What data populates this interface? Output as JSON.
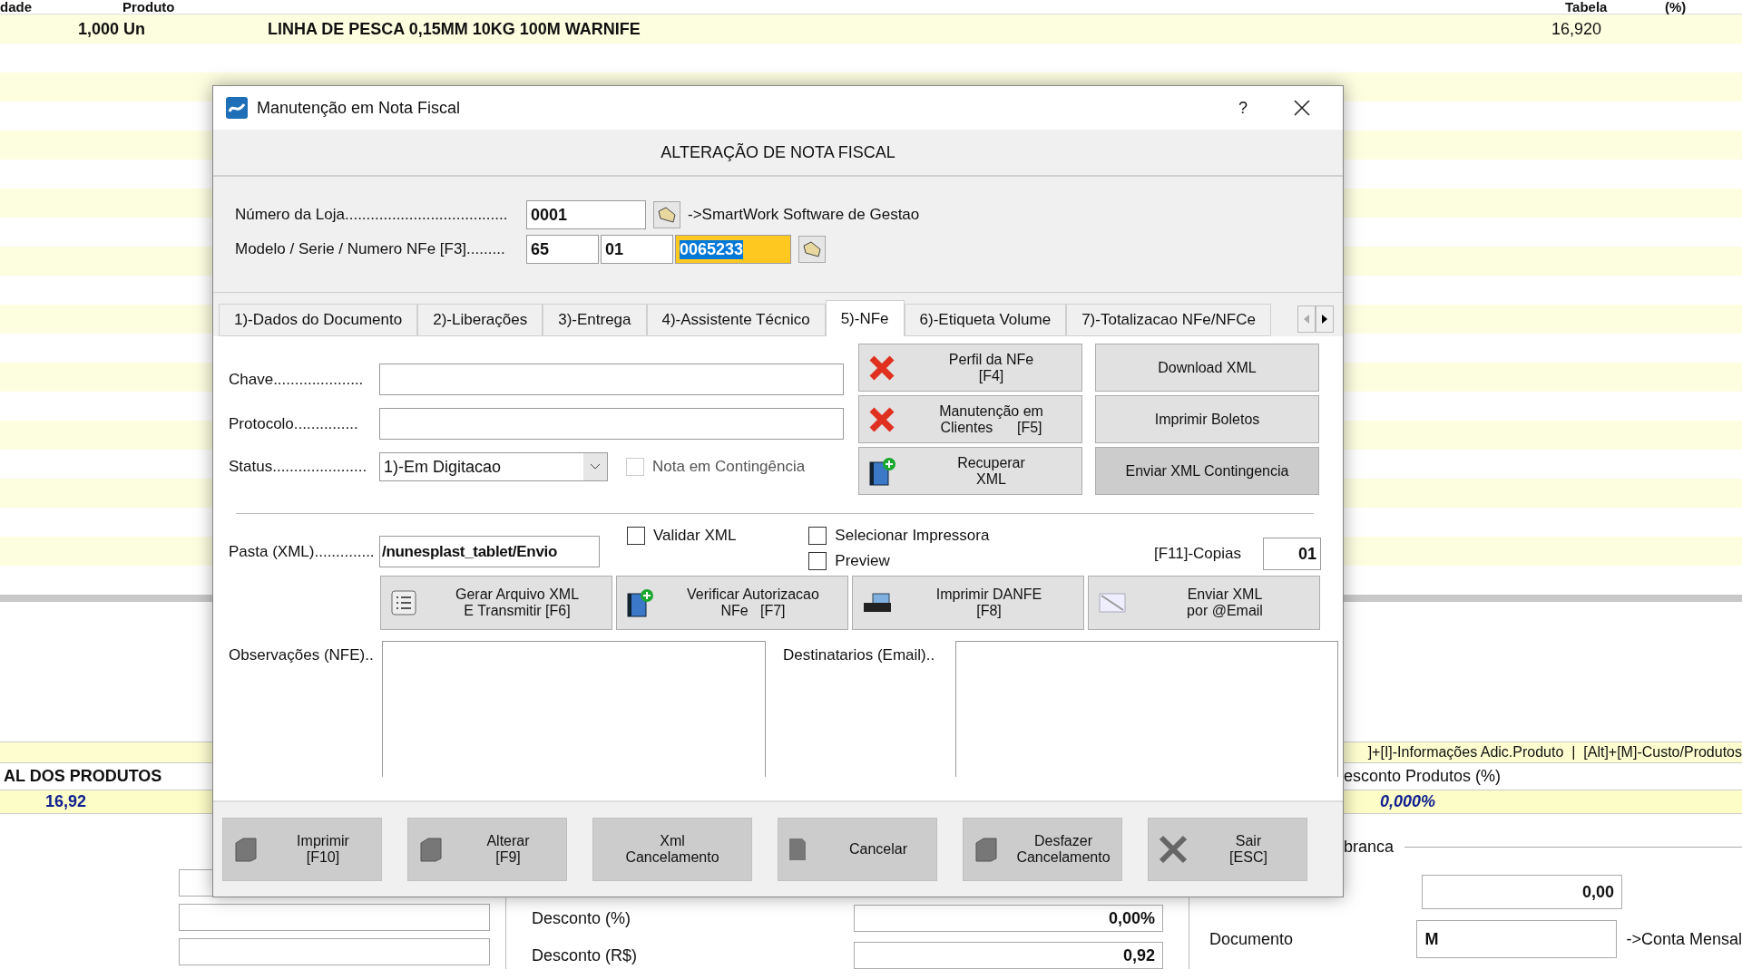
{
  "background_table": {
    "columns": [
      "dade",
      "Produto",
      "Tabela",
      "(%)"
    ],
    "rows": [
      {
        "quantity": "1,000 Un",
        "product": "LINHA DE PESCA 0,15MM 10KG 100M WARNIFE",
        "price": "16,920"
      }
    ]
  },
  "background_footer": {
    "shortcut_hint": "]+[I]-Informações Adic.Produto  |  [Alt]+[M]-Custo/Produtos",
    "total_label": "AL DOS PRODUTOS",
    "total_value": "16,92",
    "discount_products_label": "esconto Produtos (%)",
    "discount_products_value": "0,000%",
    "section_label": "branca",
    "discount_pct_label": "Desconto (%)",
    "discount_pct_value": "0,00%",
    "discount_value_label": "Desconto (R$)",
    "discount_value_value": "0,92",
    "amount_value": "0,00",
    "document_label": "Documento",
    "document_value": "M",
    "document_note": "->Conta Mensal"
  },
  "dialog": {
    "title": "Manutenção em Nota Fiscal",
    "help": "?",
    "header": "ALTERAÇÃO DE NOTA FISCAL",
    "store": {
      "label": "Número da Loja......................................",
      "value": "0001",
      "note": "->SmartWork Software de Gestao"
    },
    "model": {
      "label": "Modelo / Serie / Numero NFe [F3].........",
      "model": "65",
      "series": "01",
      "number": "0065233"
    },
    "tabs": [
      {
        "label": "1)-Dados do Documento",
        "selected": false
      },
      {
        "label": "2)-Liberações",
        "selected": false
      },
      {
        "label": "3)-Entrega",
        "selected": false
      },
      {
        "label": "4)-Assistente Técnico",
        "selected": false
      },
      {
        "label": "5)-NFe",
        "selected": true
      },
      {
        "label": "6)-Etiqueta Volume",
        "selected": false
      },
      {
        "label": "7)-Totalizacao NFe/NFCe",
        "selected": false
      }
    ],
    "nfe": {
      "chave_label": "Chave.....................",
      "protocolo_label": "Protocolo...............",
      "status_label": "Status......................",
      "status_value": "1)-Em Digitacao",
      "contingency": {
        "label": "Nota em Contingência",
        "checked": false,
        "disabled": true
      },
      "side_buttons": [
        {
          "label": "Perfil da NFe\n[F4]",
          "kind": "cross",
          "pressed": false
        },
        {
          "label": "Download XML",
          "kind": "plain",
          "pressed": false
        },
        {
          "label": "Manutenção em\nClientes      [F5]",
          "kind": "cross",
          "pressed": false
        },
        {
          "label": "Imprimir Boletos",
          "kind": "plain",
          "pressed": false
        },
        {
          "label": "Recuperar\nXML",
          "kind": "book",
          "pressed": false
        },
        {
          "label": "Enviar XML Contingencia",
          "kind": "plain",
          "pressed": true
        }
      ],
      "folder_label": "Pasta (XML)..............",
      "folder_value": "/nunesplast_tablet/Envio",
      "validate": {
        "label": "Validar XML",
        "checked": false
      },
      "printer_options": [
        {
          "label": "Selecionar Impressora",
          "checked": false
        },
        {
          "label": "Preview",
          "checked": false
        }
      ],
      "copies_label": "[F11]-Copias",
      "copies_value": "01",
      "action_buttons": [
        {
          "label": "Gerar Arquivo XML\nE Transmitir [F6]",
          "kind": "list"
        },
        {
          "label": "Verificar Autorizacao\nNFe   [F7]",
          "kind": "book"
        },
        {
          "label": "Imprimir DANFE\n[F8]",
          "kind": "printer"
        },
        {
          "label": "Enviar XML\npor @Email",
          "kind": "mail"
        }
      ],
      "notes_label": "Observações (NFE)..",
      "recipients_label": "Destinatarios (Email).."
    },
    "footer_buttons": [
      {
        "label": "Imprimir\n[F10]",
        "kind": "blob"
      },
      {
        "label": "Alterar\n[F9]",
        "kind": "blob"
      },
      {
        "label": "Xml\nCancelamento",
        "kind": "plain"
      },
      {
        "label": "Cancelar",
        "kind": "page"
      },
      {
        "label": "Desfazer\nCancelamento",
        "kind": "blob"
      },
      {
        "label": "Sair\n[ESC]",
        "kind": "x"
      }
    ]
  }
}
